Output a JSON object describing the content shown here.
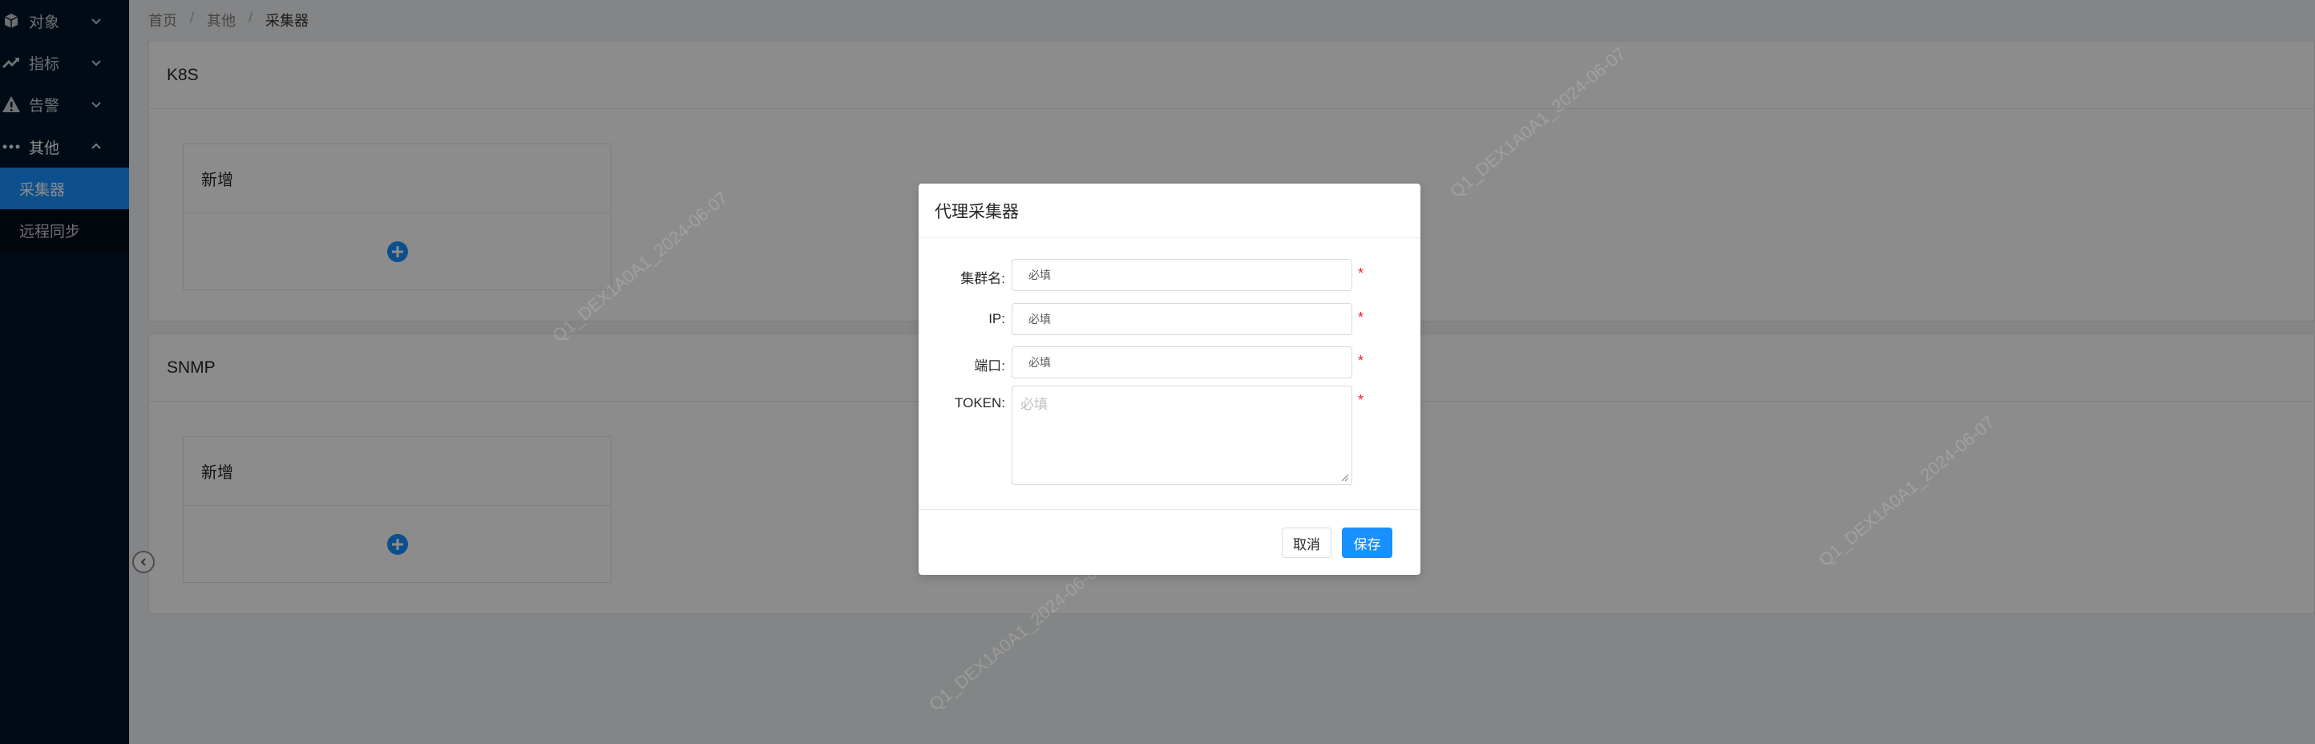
{
  "sidebar": {
    "menu": [
      {
        "label": "对象",
        "icon": "cube-icon",
        "expanded": false
      },
      {
        "label": "指标",
        "icon": "trend-icon",
        "expanded": false
      },
      {
        "label": "告警",
        "icon": "warning-icon",
        "expanded": false
      },
      {
        "label": "其他",
        "icon": "ellipsis-icon",
        "expanded": true
      }
    ],
    "submenu": [
      {
        "label": "采集器",
        "active": true
      },
      {
        "label": "远程同步",
        "active": false
      }
    ]
  },
  "breadcrumb": [
    "首页",
    "其他",
    "采集器"
  ],
  "breadcrumb_sep": "/",
  "sections": [
    {
      "title": "K8S",
      "add_label": "新增"
    },
    {
      "title": "SNMP",
      "add_label": "新增"
    }
  ],
  "watermark": "Q1_DEX1A0A1_2024-06-07",
  "modal": {
    "title": "代理采集器",
    "fields": [
      {
        "label": "集群名:",
        "value": "必填",
        "required": "*"
      },
      {
        "label": "IP:",
        "value": "必填",
        "required": "*"
      },
      {
        "label": "端口:",
        "value": "必填",
        "required": "*"
      },
      {
        "label": "TOKEN:",
        "placeholder": "必填",
        "required": "*"
      }
    ],
    "cancel_label": "取消",
    "save_label": "保存"
  },
  "colors": {
    "sidebar_bg": "#001529",
    "accent": "#1890ff",
    "required": "#f5222d"
  }
}
